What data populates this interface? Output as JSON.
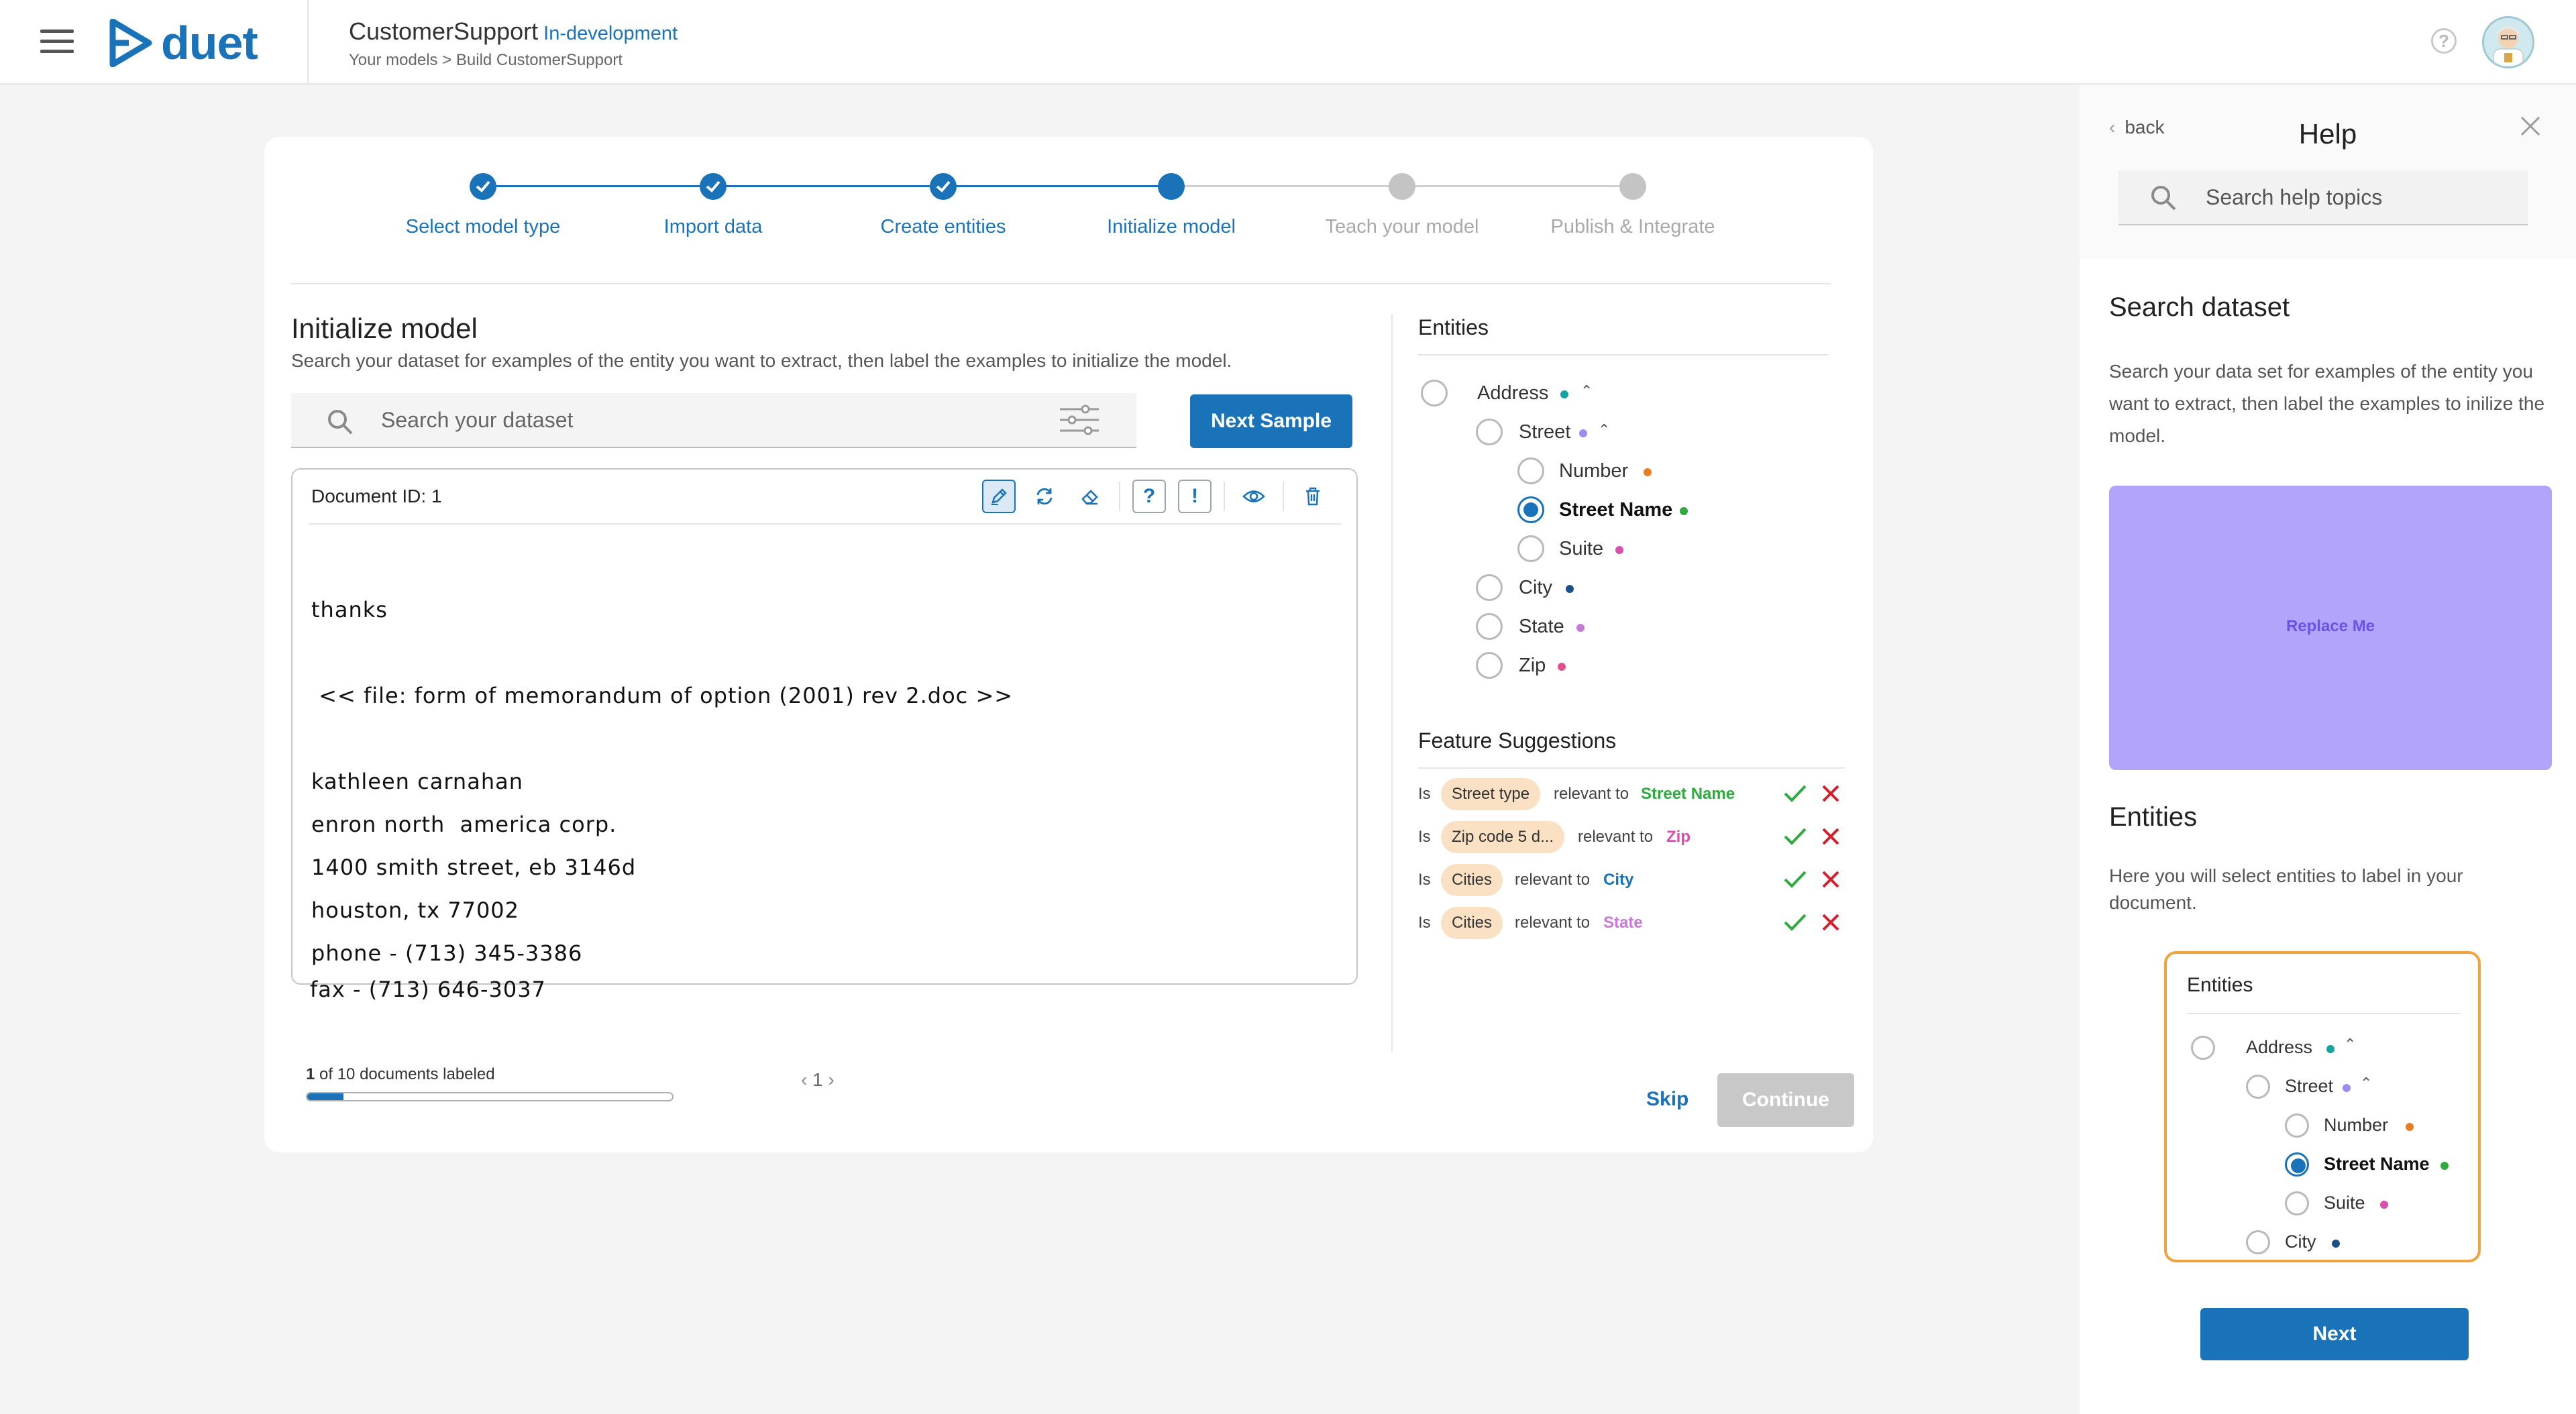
{
  "header": {
    "logo_text": "duet",
    "project_title": "CustomerSupport",
    "project_status": "In-development",
    "breadcrumb": "Your models > Build CustomerSupport",
    "help_icon": "?"
  },
  "stepper": {
    "steps": [
      {
        "label": "Select model type",
        "state": "done"
      },
      {
        "label": "Import data",
        "state": "done"
      },
      {
        "label": "Create entities",
        "state": "done"
      },
      {
        "label": "Initialize model",
        "state": "current"
      },
      {
        "label": "Teach your model",
        "state": "todo"
      },
      {
        "label": "Publish & Integrate",
        "state": "todo"
      }
    ]
  },
  "main": {
    "title": "Initialize model",
    "subtitle": "Search your dataset for examples of the entity you want to extract, then label the examples to initialize the model.",
    "search_placeholder": "Search your dataset",
    "next_sample_label": "Next Sample",
    "document": {
      "id_label": "Document ID: 1",
      "lines": [
        "thanks",
        " << file: form of memorandum of option (2001) rev 2.doc >>",
        "kathleen carnahan",
        "enron north  america corp.",
        "1400 smith street, eb 3146d",
        "houston, tx 77002",
        "phone - (713) 345-3386",
        "fax - (713) 646-3037"
      ],
      "toolbar": {
        "question_label": "?",
        "exclaim_label": "!"
      }
    },
    "progress": {
      "count": "1",
      "text": " of 10 documents labeled",
      "fraction": 0.1
    },
    "pager": {
      "page": "1"
    },
    "skip_label": "Skip",
    "continue_label": "Continue"
  },
  "entities_panel": {
    "title": "Entities",
    "items": {
      "address": "Address",
      "street": "Street",
      "number": "Number",
      "street_name": "Street Name",
      "suite": "Suite",
      "city": "City",
      "state": "State",
      "zip": "Zip"
    },
    "dot_colors": {
      "address": "#17a2a2",
      "street": "#9b8cf0",
      "number": "#e67e22",
      "street_name": "#2eaa3f",
      "suite": "#d94fae",
      "city": "#1b4f8a",
      "state": "#c77ad6",
      "zip": "#e0508f"
    }
  },
  "feature_suggestions": {
    "title": "Feature Suggestions",
    "rows": [
      {
        "is": "Is",
        "feature": "Street type",
        "relevant": "relevant to",
        "entity": "Street Name",
        "color": "#2eaa3f"
      },
      {
        "is": "Is",
        "feature": "Zip code 5 d...",
        "relevant": "relevant to",
        "entity": "Zip",
        "color": "#d94fae"
      },
      {
        "is": "Is",
        "feature": "Cities",
        "relevant": "relevant to",
        "entity": "City",
        "color": "#1a73b8"
      },
      {
        "is": "Is",
        "feature": "Cities",
        "relevant": "relevant to",
        "entity": "State",
        "color": "#c77ad6"
      }
    ]
  },
  "help": {
    "back_label": "back",
    "title": "Help",
    "search_placeholder": "Search help topics",
    "search_dataset_title": "Search dataset",
    "search_dataset_text": "Search your data set for examples of the entity you want to extract, then label the examples to inilize the model.",
    "placeholder_label": "Replace Me",
    "entities_title": "Entities",
    "entities_text": "Here you will select entities to label in your document.",
    "preview": {
      "title": "Entities",
      "address": "Address",
      "street": "Street",
      "number": "Number",
      "street_name": "Street Name",
      "suite": "Suite",
      "city": "City"
    },
    "next_label": "Next"
  }
}
